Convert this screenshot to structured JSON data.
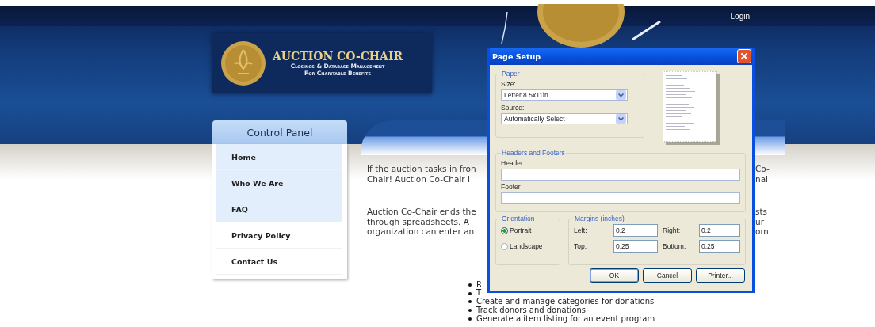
{
  "top_bar": {
    "login_link": "Login"
  },
  "logo": {
    "title": "AUCTION CO-CHAIR",
    "subtitle_lines": [
      "Closings & Database Management",
      "For Charitable Benefits"
    ]
  },
  "control_panel": {
    "title": "Control Panel",
    "items": [
      {
        "label": "Home",
        "highlighted": true
      },
      {
        "label": "Who We Are",
        "highlighted": true
      },
      {
        "label": "FAQ",
        "highlighted": true
      },
      {
        "label": "Privacy Policy",
        "highlighted": false
      },
      {
        "label": "Contact Us",
        "highlighted": false
      }
    ]
  },
  "content": {
    "paragraphs": [
      {
        "left_lines": [
          "If the auction tasks in fron",
          "Chair!  Auction Co-Chair i"
        ],
        "right_lines": [
          "Co-",
          "nal"
        ]
      },
      {
        "left_lines": [
          "Auction Co-Chair ends the",
          "through spreadsheets.  A",
          "organization can enter an"
        ],
        "right_lines": [
          "sts",
          "ur",
          "om"
        ]
      }
    ],
    "bullets": [
      "R",
      "T",
      "Create and manage categories for donations",
      "Track donors and donations",
      "Generate a item listing for an event program"
    ]
  },
  "dialog": {
    "title": "Page Setup",
    "paper": {
      "group_label": "Paper",
      "size_label": "Size:",
      "size_value": "Letter 8.5x11in.",
      "source_label": "Source:",
      "source_value": "Automatically Select"
    },
    "headers_footers": {
      "group_label": "Headers and Footers",
      "header_label": "Header",
      "footer_label": "Footer"
    },
    "orientation": {
      "group_label": "Orientation",
      "options": [
        {
          "label": "Portrait",
          "selected": true
        },
        {
          "label": "Landscape",
          "selected": false
        }
      ]
    },
    "margins": {
      "group_label": "Margins (inches)",
      "fields": [
        {
          "label": "Left:",
          "value": "0.2"
        },
        {
          "label": "Right:",
          "value": "0.2"
        },
        {
          "label": "Top:",
          "value": "0.25"
        },
        {
          "label": "Bottom:",
          "value": "0.25"
        }
      ]
    },
    "buttons": [
      {
        "label": "OK",
        "default": true
      },
      {
        "label": "Cancel",
        "default": false
      },
      {
        "label": "Printer...",
        "default": false
      }
    ]
  }
}
